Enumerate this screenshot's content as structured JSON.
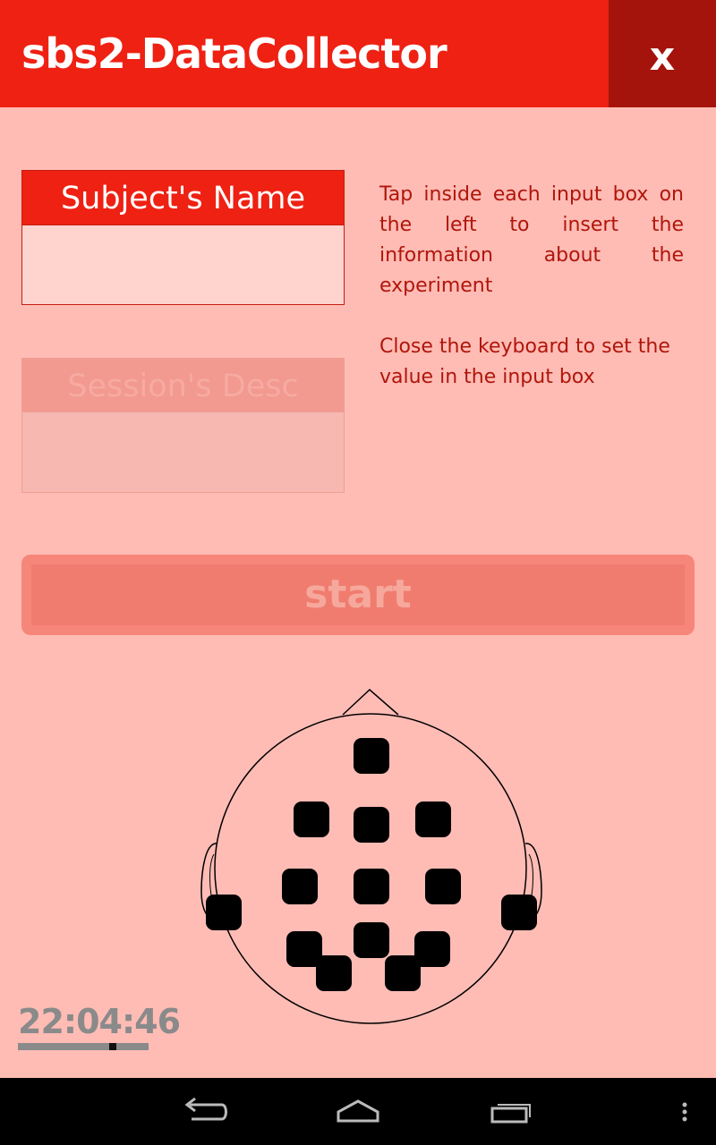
{
  "app": {
    "title": "sbs2-DataCollector",
    "close_label": "x"
  },
  "form": {
    "subject_name_label": "Subject's Name",
    "subject_name_value": "",
    "session_desc_label": "Session's Desc",
    "session_desc_value": ""
  },
  "help": {
    "paragraph1": "Tap inside each input box on the left to insert the information about the experiment",
    "paragraph2": "Close the keyboard to set the value in the input box"
  },
  "start_button": {
    "label": "start",
    "enabled": false
  },
  "status": {
    "clock": "22:04:46"
  },
  "colors": {
    "primary": "#ee2113",
    "primary_dark": "#a5140c",
    "background": "#ffbcb5",
    "help_text": "#b0160b"
  },
  "icons": {
    "nav": [
      "back-icon",
      "home-icon",
      "recent-apps-icon",
      "overflow-menu-icon"
    ]
  }
}
